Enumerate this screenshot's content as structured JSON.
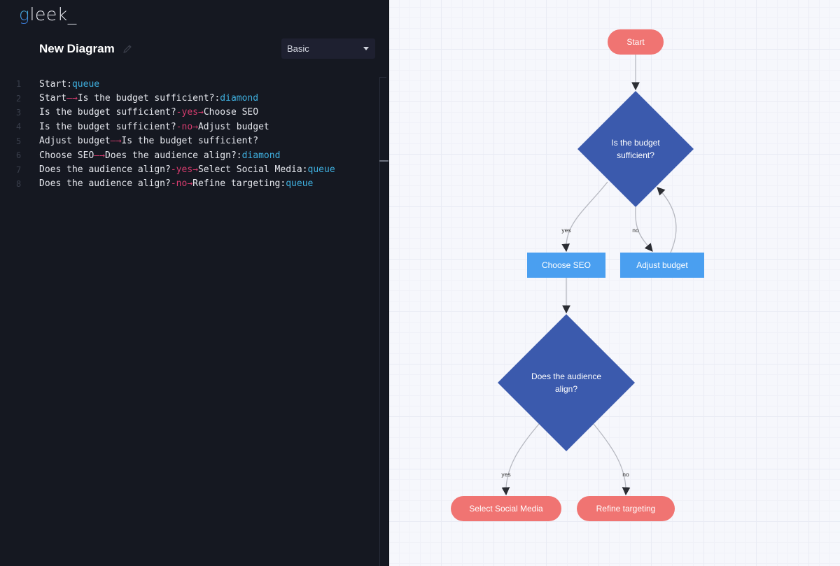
{
  "app": {
    "logo": {
      "first": "g",
      "rest": "leek_"
    }
  },
  "header": {
    "diagram_title": "New Diagram",
    "edit_icon": "pencil-icon",
    "diagram_type": {
      "selected": "Basic",
      "icon": "caret-down-icon"
    }
  },
  "editor": {
    "lines": [
      {
        "no": "1",
        "tokens": [
          {
            "t": "Start:",
            "k": "text"
          },
          {
            "t": "queue",
            "k": "shape"
          }
        ]
      },
      {
        "no": "2",
        "tokens": [
          {
            "t": "Start",
            "k": "text"
          },
          {
            "t": "—→",
            "k": "edge"
          },
          {
            "t": "Is the budget sufficient?:",
            "k": "text"
          },
          {
            "t": "diamond",
            "k": "shape"
          }
        ]
      },
      {
        "no": "3",
        "tokens": [
          {
            "t": "Is the budget sufficient?",
            "k": "text"
          },
          {
            "t": "-yes→",
            "k": "edge"
          },
          {
            "t": "Choose SEO",
            "k": "text"
          }
        ]
      },
      {
        "no": "4",
        "tokens": [
          {
            "t": "Is the budget sufficient?",
            "k": "text"
          },
          {
            "t": "-no→",
            "k": "edge"
          },
          {
            "t": "Adjust budget",
            "k": "text"
          }
        ]
      },
      {
        "no": "5",
        "tokens": [
          {
            "t": "Adjust budget",
            "k": "text"
          },
          {
            "t": "—→",
            "k": "edge"
          },
          {
            "t": "Is the budget sufficient?",
            "k": "text"
          }
        ]
      },
      {
        "no": "6",
        "tokens": [
          {
            "t": "Choose SEO",
            "k": "text"
          },
          {
            "t": "—→",
            "k": "edge"
          },
          {
            "t": "Does the audience align?:",
            "k": "text"
          },
          {
            "t": "diamond",
            "k": "shape"
          }
        ]
      },
      {
        "no": "7",
        "tokens": [
          {
            "t": "Does the audience align?",
            "k": "text"
          },
          {
            "t": "-yes→",
            "k": "edge"
          },
          {
            "t": "Select Social Media:",
            "k": "text"
          },
          {
            "t": "queue",
            "k": "shape"
          }
        ]
      },
      {
        "no": "8",
        "tokens": [
          {
            "t": "Does the audience align?",
            "k": "text"
          },
          {
            "t": "-no→",
            "k": "edge"
          },
          {
            "t": "Refine targeting:",
            "k": "text"
          },
          {
            "t": "queue",
            "k": "shape"
          }
        ]
      }
    ]
  },
  "colors": {
    "queue_fill": "#f07472",
    "diamond_fill": "#3b5aad",
    "rect_fill": "#4a9ff0",
    "edge_stroke": "#b6b8c0",
    "arrow_head": "#2b2d33",
    "syntax_shape": "#3fb0e0",
    "syntax_edge": "#d63c6e"
  },
  "diagram": {
    "nodes": [
      {
        "id": "start",
        "label": [
          "Start"
        ],
        "shape": "queue"
      },
      {
        "id": "budget",
        "label": [
          "Is the budget",
          "sufficient?"
        ],
        "shape": "diamond"
      },
      {
        "id": "seo",
        "label": [
          "Choose SEO"
        ],
        "shape": "rect"
      },
      {
        "id": "adjust",
        "label": [
          "Adjust budget"
        ],
        "shape": "rect"
      },
      {
        "id": "audience",
        "label": [
          "Does the audience",
          "align?"
        ],
        "shape": "diamond"
      },
      {
        "id": "social",
        "label": [
          "Select Social Media"
        ],
        "shape": "queue"
      },
      {
        "id": "refine",
        "label": [
          "Refine targeting"
        ],
        "shape": "queue"
      }
    ],
    "edges": [
      {
        "from": "start",
        "to": "budget",
        "label": ""
      },
      {
        "from": "budget",
        "to": "seo",
        "label": "yes"
      },
      {
        "from": "budget",
        "to": "adjust",
        "label": "no"
      },
      {
        "from": "adjust",
        "to": "budget",
        "label": ""
      },
      {
        "from": "seo",
        "to": "audience",
        "label": ""
      },
      {
        "from": "audience",
        "to": "social",
        "label": "yes"
      },
      {
        "from": "audience",
        "to": "refine",
        "label": "no"
      }
    ]
  }
}
